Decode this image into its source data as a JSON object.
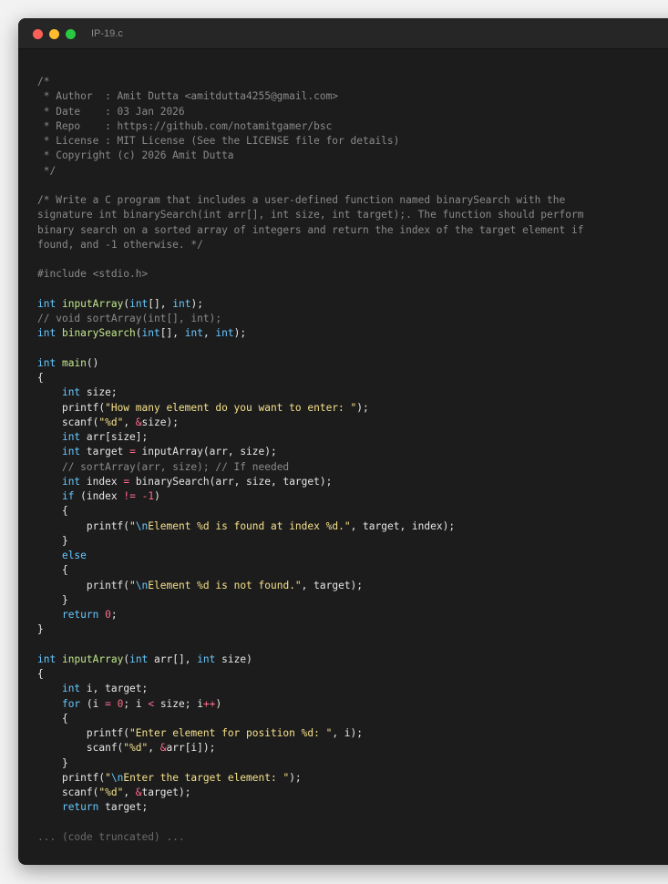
{
  "window": {
    "title": "IP-19.c"
  },
  "code_lines": [
    [
      [
        "comment",
        "/*"
      ]
    ],
    [
      [
        "comment",
        " * Author  : Amit Dutta <amitdutta4255@gmail.com>"
      ]
    ],
    [
      [
        "comment",
        " * Date    : 03 Jan 2026"
      ]
    ],
    [
      [
        "comment",
        " * Repo    : https://github.com/notamitgamer/bsc"
      ]
    ],
    [
      [
        "comment",
        " * License : MIT License (See the LICENSE file for details)"
      ]
    ],
    [
      [
        "comment",
        " * Copyright (c) 2026 Amit Dutta"
      ]
    ],
    [
      [
        "comment",
        " */"
      ]
    ],
    [],
    [
      [
        "comment",
        "/* Write a C program that includes a user-defined function named binarySearch with the"
      ]
    ],
    [
      [
        "comment",
        "signature int binarySearch(int arr[], int size, int target);. The function should perform"
      ]
    ],
    [
      [
        "comment",
        "binary search on a sorted array of integers and return the index of the target element if"
      ]
    ],
    [
      [
        "comment",
        "found, and -1 otherwise. */"
      ]
    ],
    [],
    [
      [
        "preproc",
        "#include <stdio.h>"
      ]
    ],
    [],
    [
      [
        "keyword",
        "int"
      ],
      [
        "plain",
        " "
      ],
      [
        "func",
        "inputArray"
      ],
      [
        "punct",
        "("
      ],
      [
        "keyword",
        "int"
      ],
      [
        "punct",
        "[], "
      ],
      [
        "keyword",
        "int"
      ],
      [
        "punct",
        ");"
      ]
    ],
    [
      [
        "comment",
        "// void sortArray(int[], int);"
      ]
    ],
    [
      [
        "keyword",
        "int"
      ],
      [
        "plain",
        " "
      ],
      [
        "func",
        "binarySearch"
      ],
      [
        "punct",
        "("
      ],
      [
        "keyword",
        "int"
      ],
      [
        "punct",
        "[], "
      ],
      [
        "keyword",
        "int"
      ],
      [
        "punct",
        ", "
      ],
      [
        "keyword",
        "int"
      ],
      [
        "punct",
        ");"
      ]
    ],
    [],
    [
      [
        "keyword",
        "int"
      ],
      [
        "plain",
        " "
      ],
      [
        "func",
        "main"
      ],
      [
        "punct",
        "()"
      ]
    ],
    [
      [
        "punct",
        "{"
      ]
    ],
    [
      [
        "plain",
        "    "
      ],
      [
        "keyword",
        "int"
      ],
      [
        "plain",
        " size;"
      ]
    ],
    [
      [
        "plain",
        "    printf("
      ],
      [
        "string",
        "\"How many element do you want to enter: \""
      ],
      [
        "plain",
        ");"
      ]
    ],
    [
      [
        "plain",
        "    scanf("
      ],
      [
        "string",
        "\"%d\""
      ],
      [
        "plain",
        ", "
      ],
      [
        "operator",
        "&"
      ],
      [
        "plain",
        "size);"
      ]
    ],
    [
      [
        "plain",
        "    "
      ],
      [
        "keyword",
        "int"
      ],
      [
        "plain",
        " arr[size];"
      ]
    ],
    [
      [
        "plain",
        "    "
      ],
      [
        "keyword",
        "int"
      ],
      [
        "plain",
        " target "
      ],
      [
        "operator",
        "="
      ],
      [
        "plain",
        " inputArray(arr, size);"
      ]
    ],
    [
      [
        "plain",
        "    "
      ],
      [
        "comment",
        "// sortArray(arr, size); // If needed"
      ]
    ],
    [
      [
        "plain",
        "    "
      ],
      [
        "keyword",
        "int"
      ],
      [
        "plain",
        " index "
      ],
      [
        "operator",
        "="
      ],
      [
        "plain",
        " binarySearch(arr, size, target);"
      ]
    ],
    [
      [
        "plain",
        "    "
      ],
      [
        "keyword",
        "if"
      ],
      [
        "plain",
        " (index "
      ],
      [
        "operator",
        "!="
      ],
      [
        "plain",
        " "
      ],
      [
        "operator",
        "-"
      ],
      [
        "number",
        "1"
      ],
      [
        "plain",
        ")"
      ]
    ],
    [
      [
        "plain",
        "    {"
      ]
    ],
    [
      [
        "plain",
        "        printf("
      ],
      [
        "string",
        "\""
      ],
      [
        "escape",
        "\\n"
      ],
      [
        "string",
        "Element %d is found at index %d.\""
      ],
      [
        "plain",
        ", target, index);"
      ]
    ],
    [
      [
        "plain",
        "    }"
      ]
    ],
    [
      [
        "plain",
        "    "
      ],
      [
        "keyword",
        "else"
      ]
    ],
    [
      [
        "plain",
        "    {"
      ]
    ],
    [
      [
        "plain",
        "        printf("
      ],
      [
        "string",
        "\""
      ],
      [
        "escape",
        "\\n"
      ],
      [
        "string",
        "Element %d is not found.\""
      ],
      [
        "plain",
        ", target);"
      ]
    ],
    [
      [
        "plain",
        "    }"
      ]
    ],
    [
      [
        "plain",
        "    "
      ],
      [
        "keyword",
        "return"
      ],
      [
        "plain",
        " "
      ],
      [
        "number",
        "0"
      ],
      [
        "plain",
        ";"
      ]
    ],
    [
      [
        "punct",
        "}"
      ]
    ],
    [],
    [
      [
        "keyword",
        "int"
      ],
      [
        "plain",
        " "
      ],
      [
        "func",
        "inputArray"
      ],
      [
        "punct",
        "("
      ],
      [
        "keyword",
        "int"
      ],
      [
        "plain",
        " arr[], "
      ],
      [
        "keyword",
        "int"
      ],
      [
        "plain",
        " size)"
      ]
    ],
    [
      [
        "punct",
        "{"
      ]
    ],
    [
      [
        "plain",
        "    "
      ],
      [
        "keyword",
        "int"
      ],
      [
        "plain",
        " i, target;"
      ]
    ],
    [
      [
        "plain",
        "    "
      ],
      [
        "keyword",
        "for"
      ],
      [
        "plain",
        " (i "
      ],
      [
        "operator",
        "="
      ],
      [
        "plain",
        " "
      ],
      [
        "number",
        "0"
      ],
      [
        "plain",
        "; i "
      ],
      [
        "operator",
        "<"
      ],
      [
        "plain",
        " size; i"
      ],
      [
        "operator",
        "++"
      ],
      [
        "plain",
        ")"
      ]
    ],
    [
      [
        "plain",
        "    {"
      ]
    ],
    [
      [
        "plain",
        "        printf("
      ],
      [
        "string",
        "\"Enter element for position %d: \""
      ],
      [
        "plain",
        ", i);"
      ]
    ],
    [
      [
        "plain",
        "        scanf("
      ],
      [
        "string",
        "\"%d\""
      ],
      [
        "plain",
        ", "
      ],
      [
        "operator",
        "&"
      ],
      [
        "plain",
        "arr[i]);"
      ]
    ],
    [
      [
        "plain",
        "    }"
      ]
    ],
    [
      [
        "plain",
        "    printf("
      ],
      [
        "string",
        "\""
      ],
      [
        "escape",
        "\\n"
      ],
      [
        "string",
        "Enter the target element: \""
      ],
      [
        "plain",
        ");"
      ]
    ],
    [
      [
        "plain",
        "    scanf("
      ],
      [
        "string",
        "\"%d\""
      ],
      [
        "plain",
        ", "
      ],
      [
        "operator",
        "&"
      ],
      [
        "plain",
        "target);"
      ]
    ],
    [
      [
        "plain",
        "    "
      ],
      [
        "keyword",
        "return"
      ],
      [
        "plain",
        " target;"
      ]
    ],
    [],
    [
      [
        "truncated",
        "... (code truncated) ..."
      ]
    ]
  ]
}
